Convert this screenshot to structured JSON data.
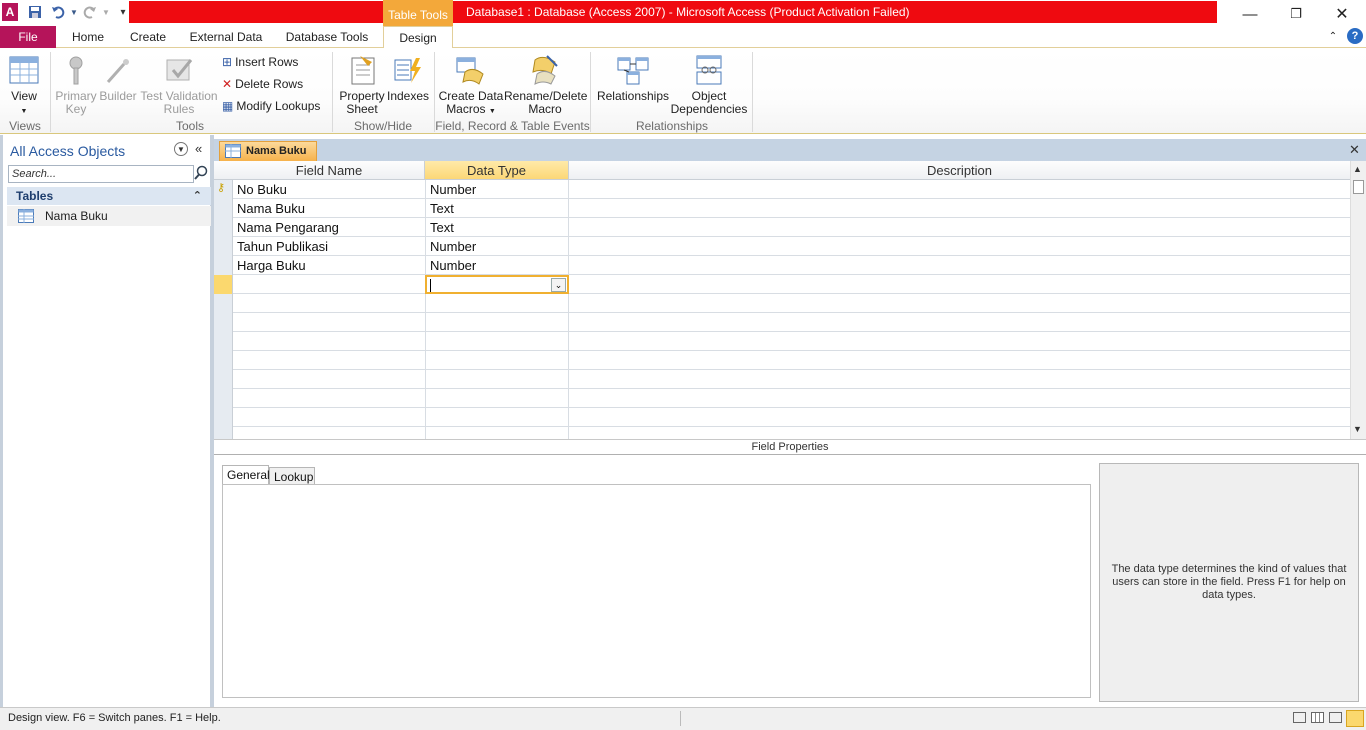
{
  "titlebar": {
    "context_tab": "Table Tools",
    "title": "Database1 : Database (Access 2007)  -  Microsoft Access (Product Activation Failed)"
  },
  "ribbon_tabs": [
    "File",
    "Home",
    "Create",
    "External Data",
    "Database Tools",
    "Design"
  ],
  "ribbon": {
    "view": "View",
    "primary_key": "Primary Key",
    "builder": "Builder",
    "test_validation": "Test Validation Rules",
    "insert_rows": "Insert Rows",
    "delete_rows": "Delete Rows",
    "modify_lookups": "Modify Lookups",
    "property_sheet": "Property Sheet",
    "indexes": "Indexes",
    "create_data_macros": "Create Data Macros",
    "rename_delete_macro": "Rename/Delete Macro",
    "relationships": "Relationships",
    "object_dependencies": "Object Dependencies",
    "groups": {
      "views": "Views",
      "tools": "Tools",
      "show_hide": "Show/Hide",
      "field_record_table_events": "Field, Record & Table Events",
      "relationships": "Relationships"
    }
  },
  "nav": {
    "header": "All Access Objects",
    "search_placeholder": "Search...",
    "section": "Tables",
    "items": [
      "Nama Buku"
    ]
  },
  "document": {
    "tab": "Nama Buku",
    "columns": [
      "Field Name",
      "Data Type",
      "Description"
    ],
    "rows": [
      {
        "field": "No Buku",
        "type": "Number",
        "desc": ""
      },
      {
        "field": "Nama Buku",
        "type": "Text",
        "desc": ""
      },
      {
        "field": "Nama Pengarang",
        "type": "Text",
        "desc": ""
      },
      {
        "field": "Tahun Publikasi",
        "type": "Number",
        "desc": ""
      },
      {
        "field": "Harga Buku",
        "type": "Number",
        "desc": ""
      }
    ],
    "field_properties_label": "Field Properties",
    "prop_tabs": [
      "General",
      "Lookup"
    ],
    "help_text": "The data type determines the kind of values that users can store in the field. Press F1 for help on data types."
  },
  "status": {
    "text": "Design view.  F6 = Switch panes.  F1 = Help."
  }
}
